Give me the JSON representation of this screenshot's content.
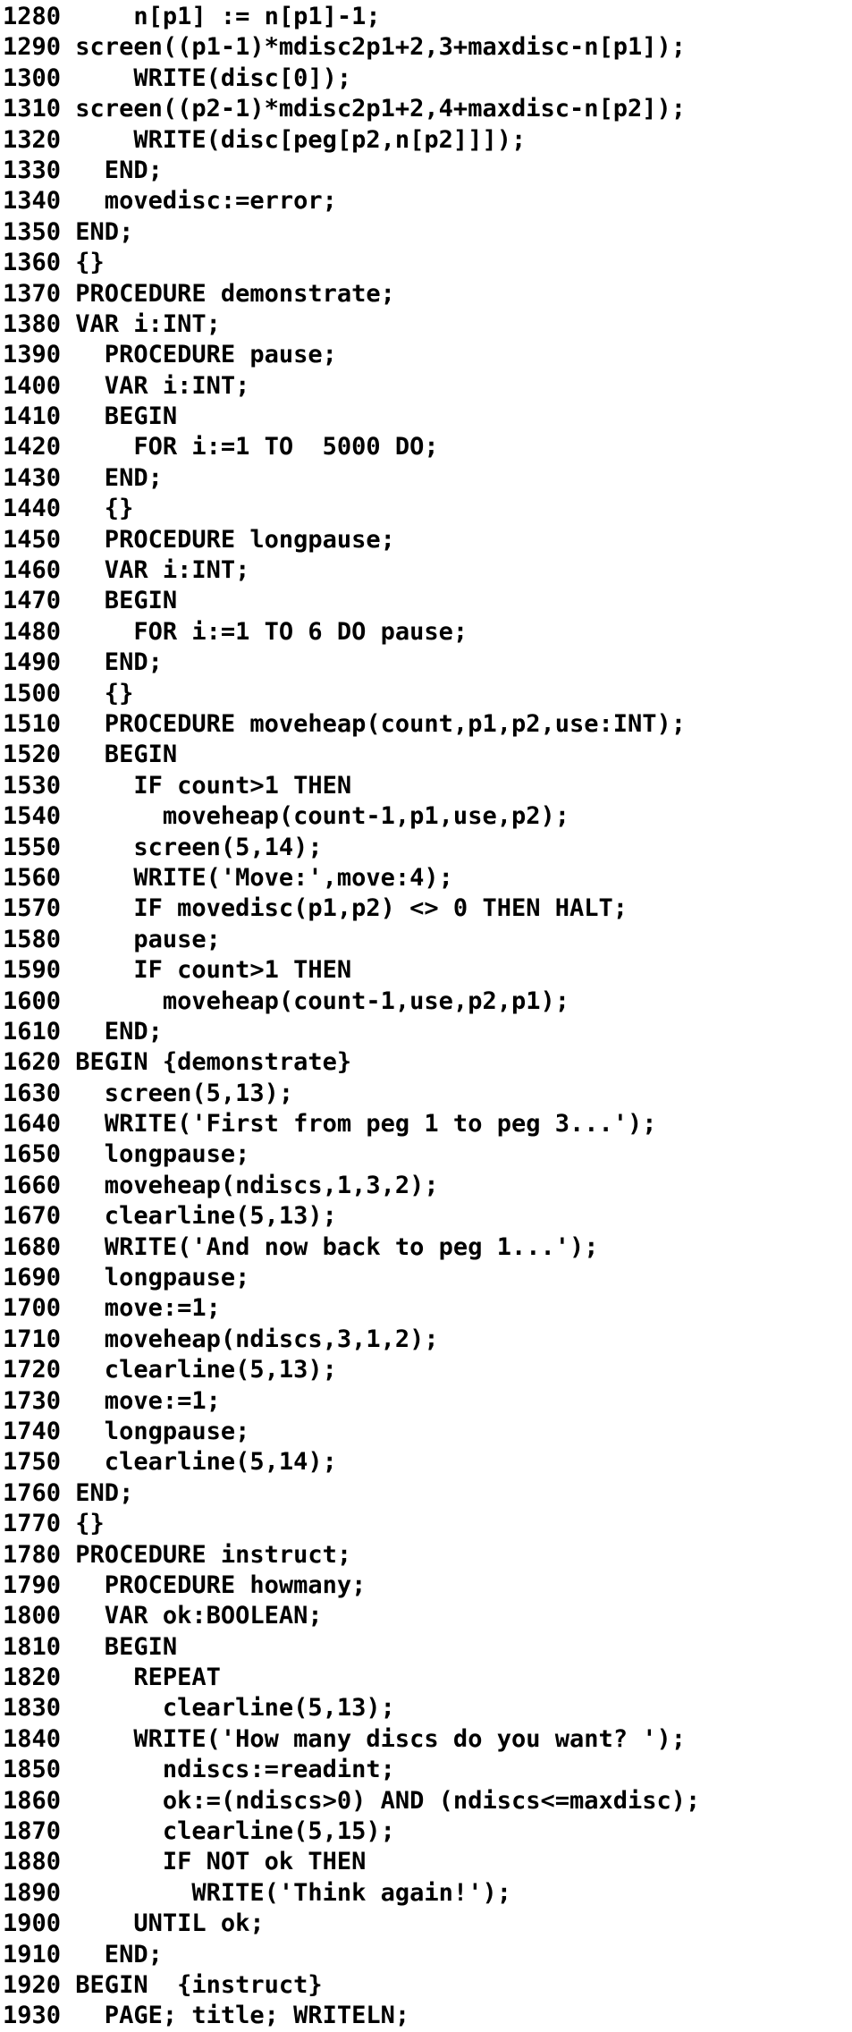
{
  "listing": {
    "lines": [
      {
        "num": "1280",
        "code": "    n[p1] := n[p1]-1;"
      },
      {
        "num": "1290",
        "code": "screen((p1-1)*mdisc2p1+2,3+maxdisc-n[p1]);"
      },
      {
        "num": "1300",
        "code": "    WRITE(disc[0]);"
      },
      {
        "num": "1310",
        "code": "screen((p2-1)*mdisc2p1+2,4+maxdisc-n[p2]);"
      },
      {
        "num": "1320",
        "code": "    WRITE(disc[peg[p2,n[p2]]]);"
      },
      {
        "num": "1330",
        "code": "  END;"
      },
      {
        "num": "1340",
        "code": "  movedisc:=error;"
      },
      {
        "num": "1350",
        "code": "END;"
      },
      {
        "num": "1360",
        "code": "{}"
      },
      {
        "num": "1370",
        "code": "PROCEDURE demonstrate;"
      },
      {
        "num": "1380",
        "code": "VAR i:INT;"
      },
      {
        "num": "1390",
        "code": "  PROCEDURE pause;"
      },
      {
        "num": "1400",
        "code": "  VAR i:INT;"
      },
      {
        "num": "1410",
        "code": "  BEGIN"
      },
      {
        "num": "1420",
        "code": "    FOR i:=1 TO  5000 DO;"
      },
      {
        "num": "1430",
        "code": "  END;"
      },
      {
        "num": "1440",
        "code": "  {}"
      },
      {
        "num": "1450",
        "code": "  PROCEDURE longpause;"
      },
      {
        "num": "1460",
        "code": "  VAR i:INT;"
      },
      {
        "num": "1470",
        "code": "  BEGIN"
      },
      {
        "num": "1480",
        "code": "    FOR i:=1 TO 6 DO pause;"
      },
      {
        "num": "1490",
        "code": "  END;"
      },
      {
        "num": "1500",
        "code": "  {}"
      },
      {
        "num": "1510",
        "code": "  PROCEDURE moveheap(count,p1,p2,use:INT);"
      },
      {
        "num": "1520",
        "code": "  BEGIN"
      },
      {
        "num": "1530",
        "code": "    IF count>1 THEN"
      },
      {
        "num": "1540",
        "code": "      moveheap(count-1,p1,use,p2);"
      },
      {
        "num": "1550",
        "code": "    screen(5,14);"
      },
      {
        "num": "1560",
        "code": "    WRITE('Move:',move:4);"
      },
      {
        "num": "1570",
        "code": "    IF movedisc(p1,p2) <> 0 THEN HALT;"
      },
      {
        "num": "1580",
        "code": "    pause;"
      },
      {
        "num": "1590",
        "code": "    IF count>1 THEN"
      },
      {
        "num": "1600",
        "code": "      moveheap(count-1,use,p2,p1);"
      },
      {
        "num": "1610",
        "code": "  END;"
      },
      {
        "num": "1620",
        "code": "BEGIN {demonstrate}"
      },
      {
        "num": "1630",
        "code": "  screen(5,13);"
      },
      {
        "num": "1640",
        "code": "  WRITE('First from peg 1 to peg 3...');"
      },
      {
        "num": "1650",
        "code": "  longpause;"
      },
      {
        "num": "1660",
        "code": "  moveheap(ndiscs,1,3,2);"
      },
      {
        "num": "1670",
        "code": "  clearline(5,13);"
      },
      {
        "num": "1680",
        "code": "  WRITE('And now back to peg 1...');"
      },
      {
        "num": "1690",
        "code": "  longpause;"
      },
      {
        "num": "1700",
        "code": "  move:=1;"
      },
      {
        "num": "1710",
        "code": "  moveheap(ndiscs,3,1,2);"
      },
      {
        "num": "1720",
        "code": "  clearline(5,13);"
      },
      {
        "num": "1730",
        "code": "  move:=1;"
      },
      {
        "num": "1740",
        "code": "  longpause;"
      },
      {
        "num": "1750",
        "code": "  clearline(5,14);"
      },
      {
        "num": "1760",
        "code": "END;"
      },
      {
        "num": "1770",
        "code": "{}"
      },
      {
        "num": "1780",
        "code": "PROCEDURE instruct;"
      },
      {
        "num": "1790",
        "code": "  PROCEDURE howmany;"
      },
      {
        "num": "1800",
        "code": "  VAR ok:BOOLEAN;"
      },
      {
        "num": "1810",
        "code": "  BEGIN"
      },
      {
        "num": "1820",
        "code": "    REPEAT"
      },
      {
        "num": "1830",
        "code": "      clearline(5,13);"
      },
      {
        "num": "1840",
        "code": "    WRITE('How many discs do you want? ');"
      },
      {
        "num": "1850",
        "code": "      ndiscs:=readint;"
      },
      {
        "num": "1860",
        "code": "      ok:=(ndiscs>0) AND (ndiscs<=maxdisc);"
      },
      {
        "num": "1870",
        "code": "      clearline(5,15);"
      },
      {
        "num": "1880",
        "code": "      IF NOT ok THEN"
      },
      {
        "num": "1890",
        "code": "        WRITE('Think again!');"
      },
      {
        "num": "1900",
        "code": "    UNTIL ok;"
      },
      {
        "num": "1910",
        "code": "  END;"
      },
      {
        "num": "1920",
        "code": "BEGIN  {instruct}"
      },
      {
        "num": "1930",
        "code": "  PAGE; title; WRITELN;"
      }
    ]
  }
}
